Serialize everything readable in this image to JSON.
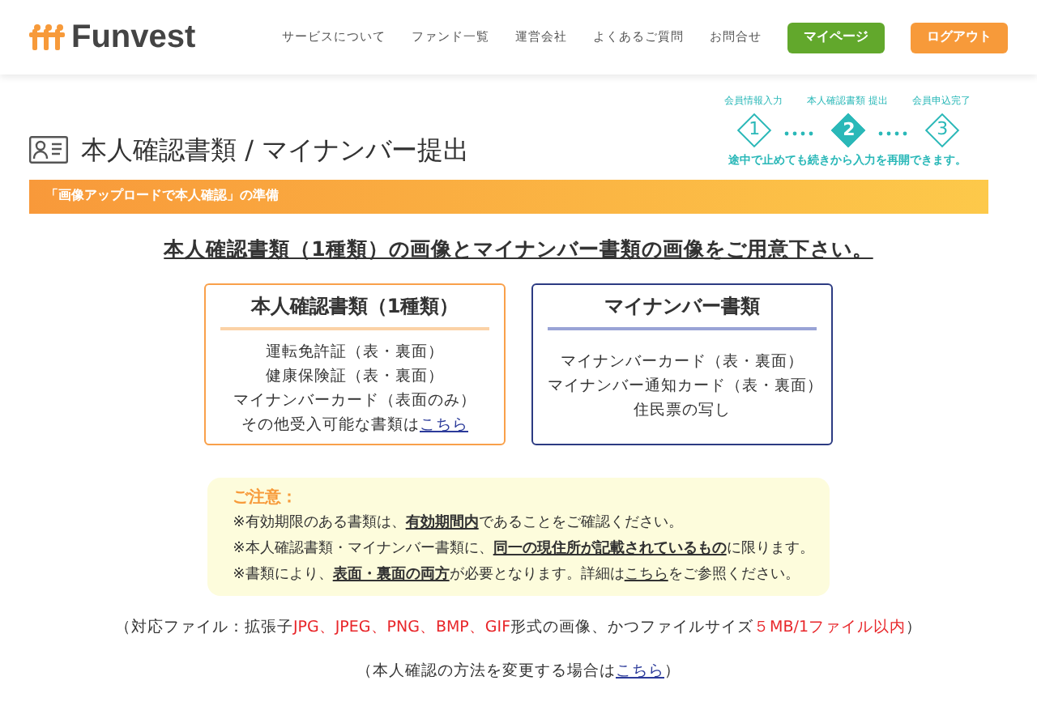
{
  "header": {
    "logo": "Funvest",
    "nav": [
      "サービスについて",
      "ファンド一覧",
      "運営会社",
      "よくあるご質問",
      "お問合せ"
    ],
    "buttons": [
      {
        "label": "マイページ",
        "kind": "mypage"
      },
      {
        "label": "ログアウト",
        "kind": "logout"
      }
    ]
  },
  "steps": [
    {
      "label": "会員情報入力",
      "number": "1",
      "selected": false
    },
    {
      "label": "本人確認書類 提出",
      "number": "2",
      "selected": true
    },
    {
      "label": "会員申込完了",
      "number": "3",
      "selected": false
    }
  ],
  "steps_note": "途中で止めても続きから入力を再開できます。",
  "page_title": "本人確認書類 / マイナンバー提出",
  "section_bar": "「画像アップロードで本人確認」の準備",
  "lead": "本人確認書類（1種類）の画像とマイナンバー書類の画像をご用意下さい。",
  "doc_boxes": [
    {
      "title": "本人確認書類（1種類）",
      "kind": "identity",
      "lines": [
        [
          {
            "kind": "text",
            "text": "運転免許証（表・裏面）"
          }
        ],
        [
          {
            "kind": "text",
            "text": "健康保険証（表・裏面）"
          }
        ],
        [
          {
            "kind": "text",
            "text": "マイナンバーカード（表面のみ）"
          }
        ],
        [
          {
            "kind": "text",
            "text": "その他受入可能な書類は"
          },
          {
            "kind": "link",
            "text": "こちら"
          }
        ]
      ]
    },
    {
      "title": "マイナンバー書類",
      "kind": "mynumber",
      "lines": [
        [
          {
            "kind": "text",
            "text": "マイナンバーカード（表・裏面）"
          }
        ],
        [
          {
            "kind": "text",
            "text": "マイナンバー通知カード（表・裏面）"
          }
        ],
        [
          {
            "kind": "text",
            "text": "住民票の写し"
          }
        ]
      ]
    }
  ],
  "notice": {
    "title": "ご注意：",
    "lines": [
      [
        {
          "kind": "text",
          "text": "※有効期限のある書類は、"
        },
        {
          "kind": "strong",
          "text": "有効期間内"
        },
        {
          "kind": "text",
          "text": "であることをご確認ください。"
        }
      ],
      [
        {
          "kind": "text",
          "text": "※本人確認書類・マイナンバー書類に、"
        },
        {
          "kind": "strong",
          "text": "同一の現住所が記載されているもの"
        },
        {
          "kind": "text",
          "text": "に限ります。"
        }
      ],
      [
        {
          "kind": "text",
          "text": "※書類により、"
        },
        {
          "kind": "strong",
          "text": "表面・裏面の両方"
        },
        {
          "kind": "text",
          "text": "が必要となります。詳細は"
        },
        {
          "kind": "underline",
          "text": "こちら"
        },
        {
          "kind": "text",
          "text": "をご参照ください。"
        }
      ]
    ]
  },
  "file_note": [
    {
      "kind": "text",
      "text": "（対応ファイル：拡張子"
    },
    {
      "kind": "red",
      "text": "JPG、JPEG、PNG、BMP、GIF"
    },
    {
      "kind": "text",
      "text": "形式の画像、かつファイルサイズ"
    },
    {
      "kind": "red",
      "text": "５MB/1ファイル以内"
    },
    {
      "kind": "text",
      "text": "）"
    }
  ],
  "change_note": [
    {
      "kind": "text",
      "text": "（本人確認の方法を変更する場合は"
    },
    {
      "kind": "link",
      "text": "こちら"
    },
    {
      "kind": "text",
      "text": "）"
    }
  ]
}
